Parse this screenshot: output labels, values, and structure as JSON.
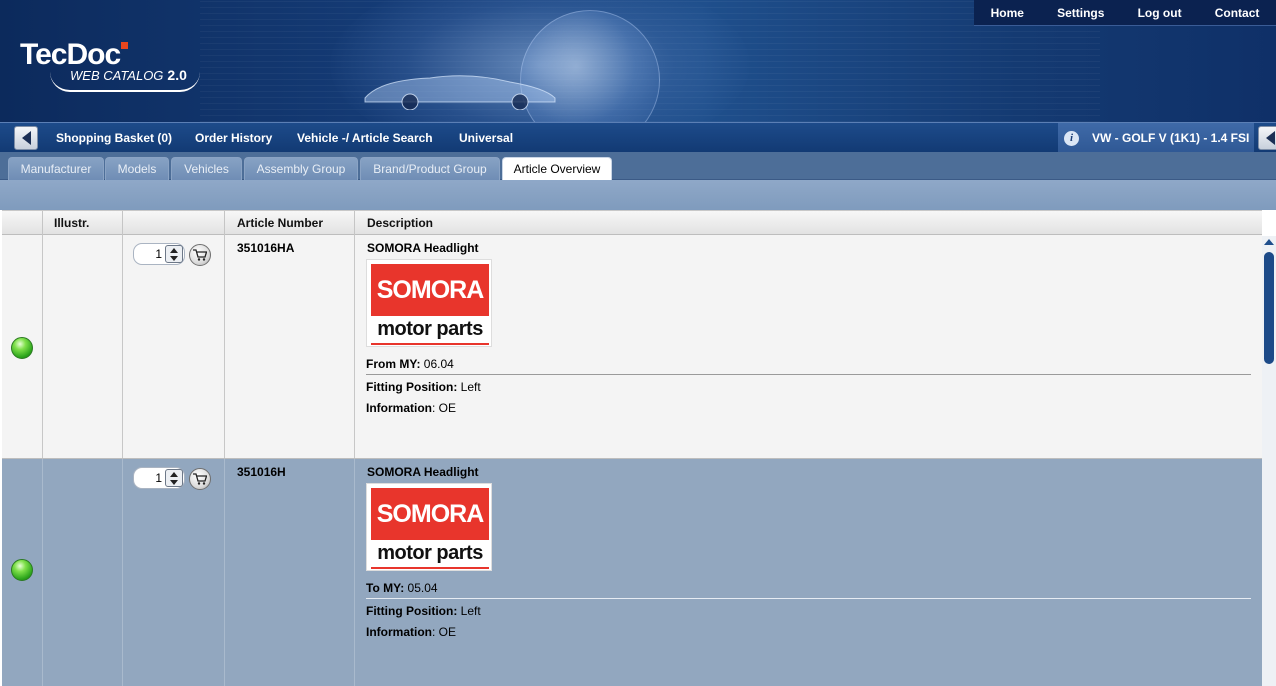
{
  "logo": {
    "name": "TecDoc",
    "sub": "WEB CATALOG",
    "version": "2.0"
  },
  "topnav": [
    "Home",
    "Settings",
    "Log out",
    "Contact"
  ],
  "menubar": {
    "shopping_basket": "Shopping Basket (0)",
    "order_history": "Order History",
    "vehicle_search": "Vehicle -/ Article Search",
    "universal": "Universal",
    "vehicle": "VW - GOLF V (1K1) - 1.4 FSI",
    "info_glyph": "i"
  },
  "tabs": [
    "Manufacturer",
    "Models",
    "Vehicles",
    "Assembly Group",
    "Brand/Product Group",
    "Article Overview"
  ],
  "table": {
    "headers": {
      "illustr": "Illustr.",
      "article_number": "Article Number",
      "description": "Description"
    },
    "rows": [
      {
        "qty": "1",
        "article_number": "351016HA",
        "title": "SOMORA Headlight",
        "logo_top": "SOMORA",
        "logo_bottom": "motor parts",
        "my_label": "From MY:",
        "my_value": " 06.04",
        "fit_label": "Fitting Position:",
        "fit_value": " Left",
        "info_label": "Information",
        "info_value": ": OE"
      },
      {
        "qty": "1",
        "article_number": "351016H",
        "title": "SOMORA Headlight",
        "logo_top": "SOMORA",
        "logo_bottom": "motor parts",
        "my_label": "To MY:",
        "my_value": " 05.04",
        "fit_label": "Fitting Position:",
        "fit_value": " Left",
        "info_label": "Information",
        "info_value": ": OE"
      }
    ]
  },
  "colors": {
    "status": "#3cc126",
    "banner": "#163e7a",
    "accent": "#e8352c",
    "row_alt": "#92a7bf"
  }
}
